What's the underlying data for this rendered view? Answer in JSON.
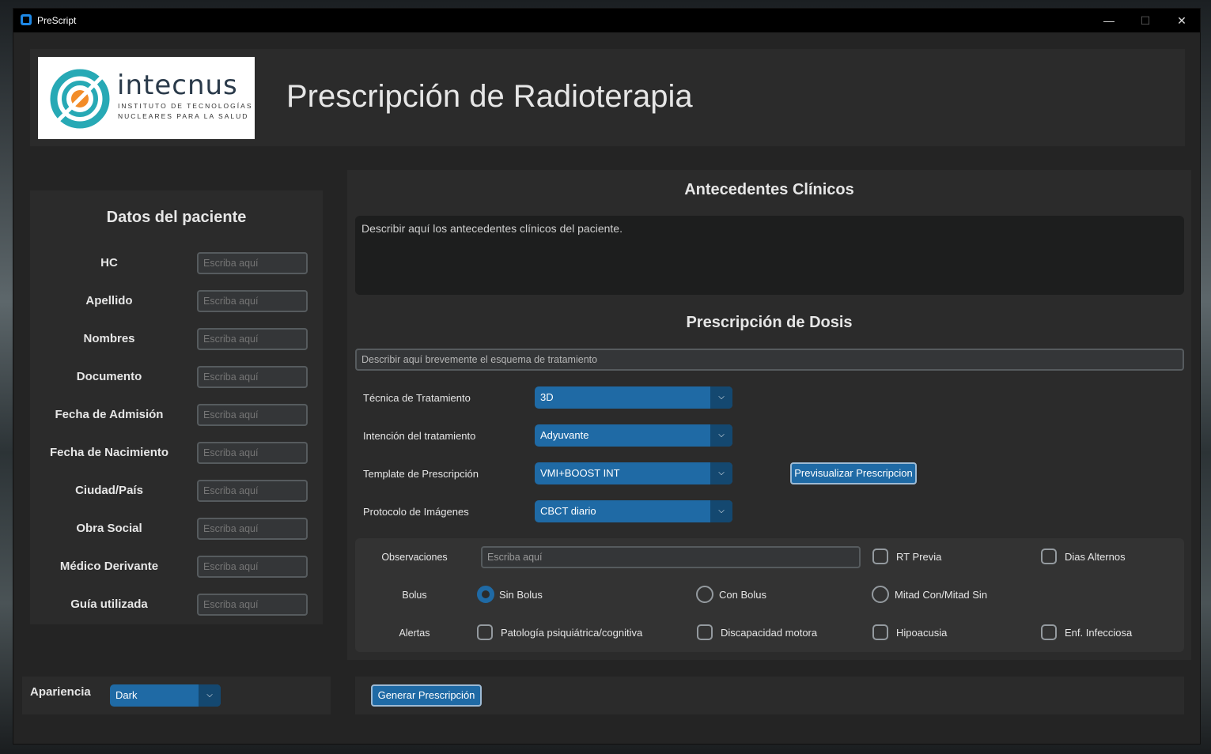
{
  "window": {
    "title": "PreScript",
    "controls": {
      "minimize": "—",
      "maximize": "☐",
      "close": "✕"
    }
  },
  "header": {
    "logo": {
      "word": "intecnus",
      "sub1": "INSTITUTO DE TECNOLOGÍAS",
      "sub2": "NUCLEARES PARA LA SALUD"
    },
    "title": "Prescripción de Radioterapia"
  },
  "patient": {
    "title": "Datos del paciente",
    "placeholder": "Escriba aquí",
    "fields": [
      {
        "label": "HC"
      },
      {
        "label": "Apellido"
      },
      {
        "label": "Nombres"
      },
      {
        "label": "Documento"
      },
      {
        "label": "Fecha de Admisión"
      },
      {
        "label": "Fecha de Nacimiento"
      },
      {
        "label": "Ciudad/País"
      },
      {
        "label": "Obra Social"
      },
      {
        "label": "Médico Derivante"
      },
      {
        "label": "Guía utilizada"
      }
    ]
  },
  "clinical": {
    "title": "Antecedentes Clínicos",
    "text": "Describir aquí los antecedentes clínicos del paciente."
  },
  "dose": {
    "title": "Prescripción de Dosis",
    "scheme_placeholder": "Describir aquí brevemente el esquema de tratamiento",
    "technique": {
      "label": "Técnica de Tratamiento",
      "value": "3D"
    },
    "intent": {
      "label": "Intención del tratamiento",
      "value": "Adyuvante"
    },
    "template": {
      "label": "Template de Prescripción",
      "value": "VMI+BOOST INT"
    },
    "imaging": {
      "label": "Protocolo de Imágenes",
      "value": "CBCT diario"
    },
    "preview_button": "Previsualizar Prescripcion"
  },
  "options": {
    "observaciones": {
      "label": "Observaciones",
      "placeholder": "Escriba aquí"
    },
    "rt_previa": "RT Previa",
    "dias_alternos": "Dias Alternos",
    "bolus": {
      "label": "Bolus",
      "options": [
        "Sin Bolus",
        "Con Bolus",
        "Mitad Con/Mitad Sin"
      ],
      "selected": "Sin Bolus"
    },
    "alertas": {
      "label": "Alertas",
      "items": [
        "Patología psiquiátrica/cognitiva",
        "Discapacidad motora",
        "Hipoacusia",
        "Enf. Infecciosa"
      ]
    }
  },
  "appearance": {
    "label": "Apariencia",
    "value": "Dark"
  },
  "footer": {
    "generate_button": "Generar Prescripción"
  },
  "colors": {
    "accent": "#1f6aa5",
    "accent_dark": "#144870",
    "panel": "#2b2b2b",
    "background": "#242424"
  }
}
